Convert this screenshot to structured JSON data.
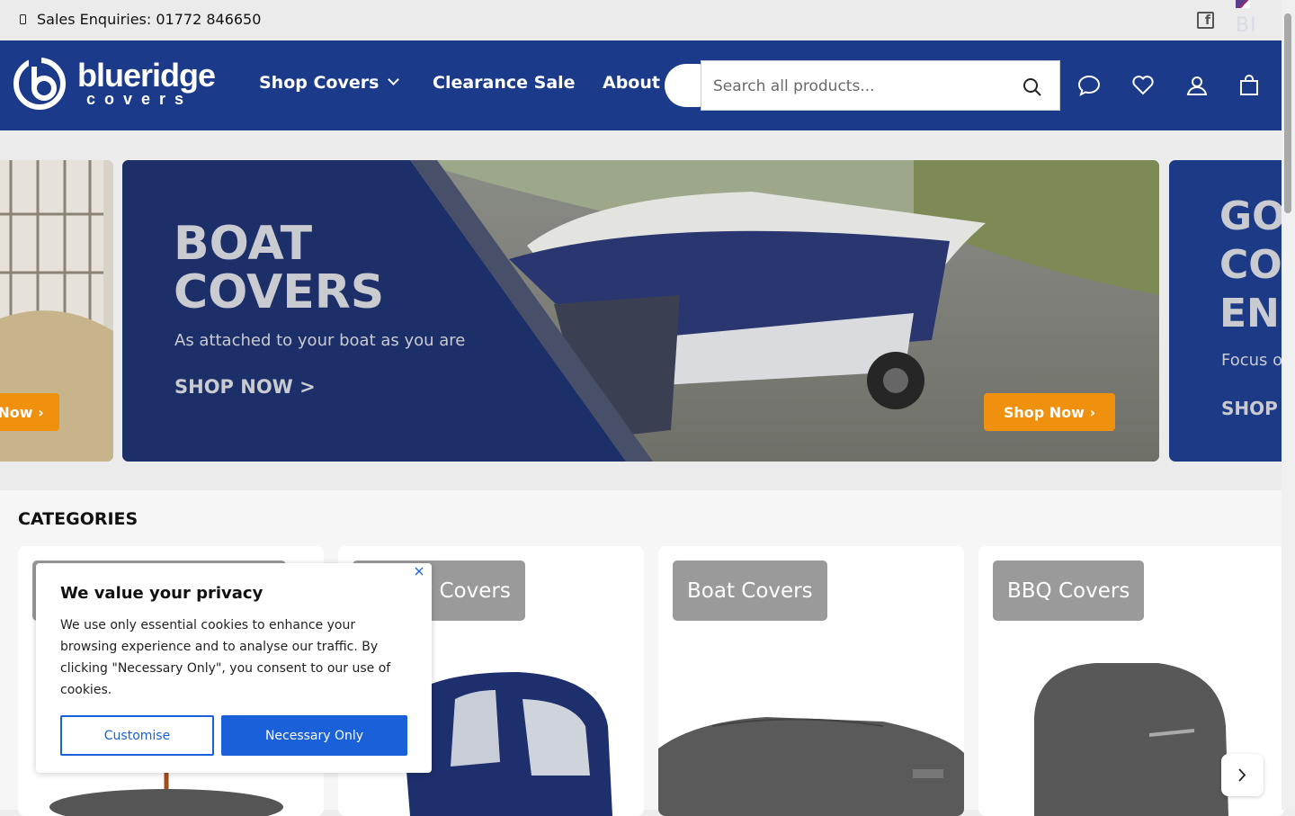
{
  "topbar": {
    "sales_enquiries": "Sales Enquiries: 01772 846650",
    "language_code": "BI"
  },
  "header": {
    "logo_text_main": "blueridge",
    "logo_text_sub": "covers",
    "nav": [
      {
        "label": "Shop Covers",
        "has_dropdown": true
      },
      {
        "label": "Clearance Sale"
      },
      {
        "label": "About"
      }
    ],
    "search": {
      "placeholder": "Search all products..."
    },
    "icons": [
      "chat-icon",
      "heart-icon",
      "account-icon",
      "bag-icon"
    ]
  },
  "carousel": {
    "main_slide": {
      "title_line1": "BOAT",
      "title_line2": "COVERS",
      "subtitle": "As attached to your boat as you are",
      "cta": "SHOP NOW >",
      "button": "Shop Now"
    },
    "prev_slide": {
      "button": "Now"
    },
    "next_slide": {
      "title_line1": "GO",
      "title_line2": "CO",
      "title_line3": "EN",
      "subtitle": "Focus o",
      "cta": "SHOP"
    }
  },
  "categories": {
    "heading": "CATEGORIES",
    "items": [
      {
        "label": ""
      },
      {
        "label": "Buggy Covers"
      },
      {
        "label": "Boat Covers"
      },
      {
        "label": "BBQ Covers"
      }
    ]
  },
  "cookie_banner": {
    "title": "We value your privacy",
    "text": "We use only essential cookies to enhance your browsing experience and to analyse our traffic. By clicking \"Necessary Only\", you consent to our use of cookies.",
    "customise_label": "Customise",
    "necessary_label": "Necessary Only"
  },
  "colors": {
    "header_bg": "#1b3a8a",
    "accent_orange": "#f0900f",
    "cookie_button_blue": "#1a60d8"
  }
}
